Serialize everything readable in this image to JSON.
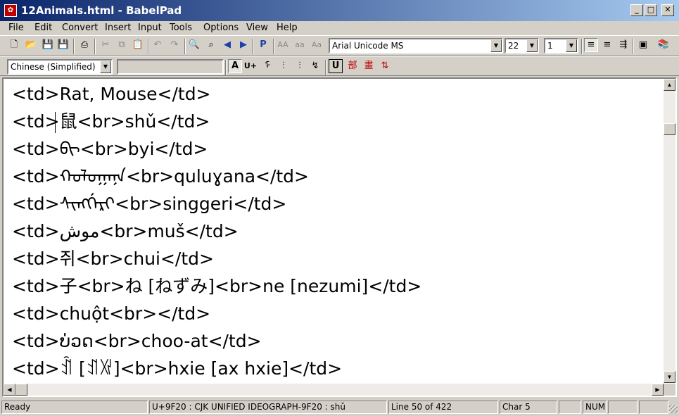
{
  "window": {
    "title": "12Animals.html - BabelPad",
    "app_icon": "babelpad-logo"
  },
  "menubar": [
    "File",
    "Edit",
    "Convert",
    "Insert",
    "Input",
    "Tools",
    "Options",
    "View",
    "Help"
  ],
  "toolbar1": {
    "font_name": "Arial Unicode MS",
    "font_size": "22",
    "line_spacing": "1",
    "buttons": {
      "bold_a": "A",
      "small_aa": "AA",
      "lower_aa": "aa",
      "mixed_aa": "Aa",
      "p_label": "P"
    }
  },
  "toolbar2": {
    "language": "Chinese (Simplified)",
    "input_method": "",
    "buttons": {
      "a": "A",
      "u_plus": "U+",
      "u": "U"
    }
  },
  "editor": {
    "lines": [
      "<td>Rat, Mouse</td>",
      "<td>鼠<br>shǔ</td>",
      "<td>ᠪᠢ<br>byi</td>",
      "<td>ᠬᠤᠯᠤᠭᠠᠨᠠ<br>quluɣana</td>",
      "<td>ᠰᡳᠩᡤᡝᡵᡳ<br>singgeri</td>",
      "<td>موش<br>muš</td>",
      "<td>쥐<br>chui</td>",
      "<td>子<br>ね [ねずみ]<br>ne [nezumi]</td>",
      "<td>chuột<br></td>",
      "<td>ບ່ວດ<br>choo-at</td>",
      "<td>ꀉ [ꀊꑟ]<br>hxie [ax hxie]</td>"
    ]
  },
  "statusbar": {
    "state": "Ready",
    "char_info": "U+9F20 : CJK UNIFIED IDEOGRAPH-9F20 : shǔ",
    "line_info": "Line 50 of 422",
    "char_pos": "Char 5",
    "num": "NUM"
  }
}
